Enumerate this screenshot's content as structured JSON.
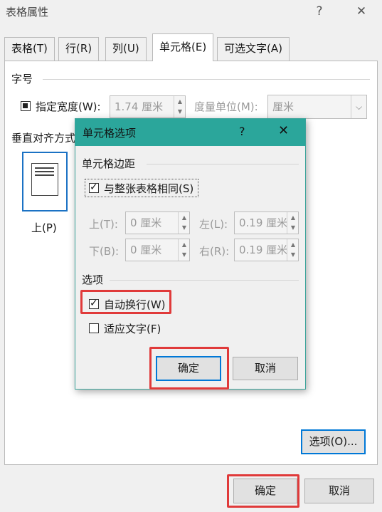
{
  "window": {
    "title": "表格属性",
    "help": "?",
    "close": "✕"
  },
  "tabs": [
    "表格(T)",
    "行(R)",
    "列(U)",
    "单元格(E)",
    "可选文字(A)"
  ],
  "size_group": {
    "title": "字号",
    "width_label": "指定宽度(W):",
    "width_value": "1.74 厘米",
    "unit_label": "度量单位(M):",
    "unit_value": "厘米"
  },
  "valign": {
    "title": "垂直对齐方式",
    "top_label": "上(P)"
  },
  "options_button": "选项(O)...",
  "footer": {
    "ok": "确定",
    "cancel": "取消"
  },
  "dialog": {
    "title": "单元格选项",
    "help": "?",
    "close": "✕",
    "margins_title": "单元格边距",
    "same_as_table": "与整张表格相同(S)",
    "top_label": "上(T):",
    "top_value": "0 厘米",
    "left_label": "左(L):",
    "left_value": "0.19 厘米",
    "bottom_label": "下(B):",
    "bottom_value": "0 厘米",
    "right_label": "右(R):",
    "right_value": "0.19 厘米",
    "options_title": "选项",
    "wrap_text": "自动换行(W)",
    "fit_text": "适应文字(F)",
    "ok": "确定",
    "cancel": "取消"
  },
  "colors": {
    "accent": "#2ba69b",
    "highlight": "#e03a3a",
    "focus": "#0078d7"
  }
}
